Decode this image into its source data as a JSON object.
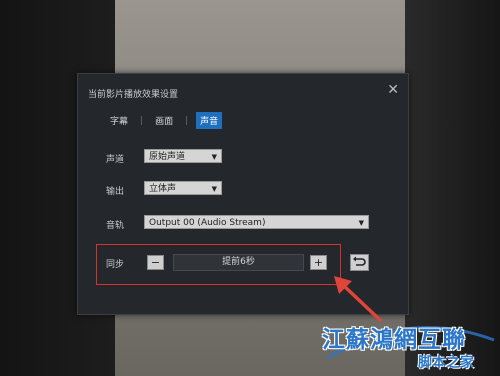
{
  "dialog": {
    "title": "当前影片播放效果设置",
    "close_glyph": "✕"
  },
  "tabs": [
    {
      "label": "字幕",
      "active": false
    },
    {
      "label": "画面",
      "active": false
    },
    {
      "label": "声音",
      "active": true
    }
  ],
  "tab_separator": "|",
  "channel": {
    "label": "声道",
    "value": "原始声道"
  },
  "output": {
    "label": "输出",
    "value": "立体声"
  },
  "track": {
    "label": "音轨",
    "value": "Output 00 (Audio Stream)"
  },
  "sync": {
    "label": "同步",
    "minus": "−",
    "plus": "+",
    "value": "提前6秒"
  },
  "colors": {
    "accent": "#1e6fbd",
    "highlight_box": "#d9302c",
    "arrow": "#e0443a",
    "watermark": "#2c76c8"
  },
  "watermark": {
    "line1": "江蘇鴻網互聯",
    "line2": "脚本之家"
  }
}
